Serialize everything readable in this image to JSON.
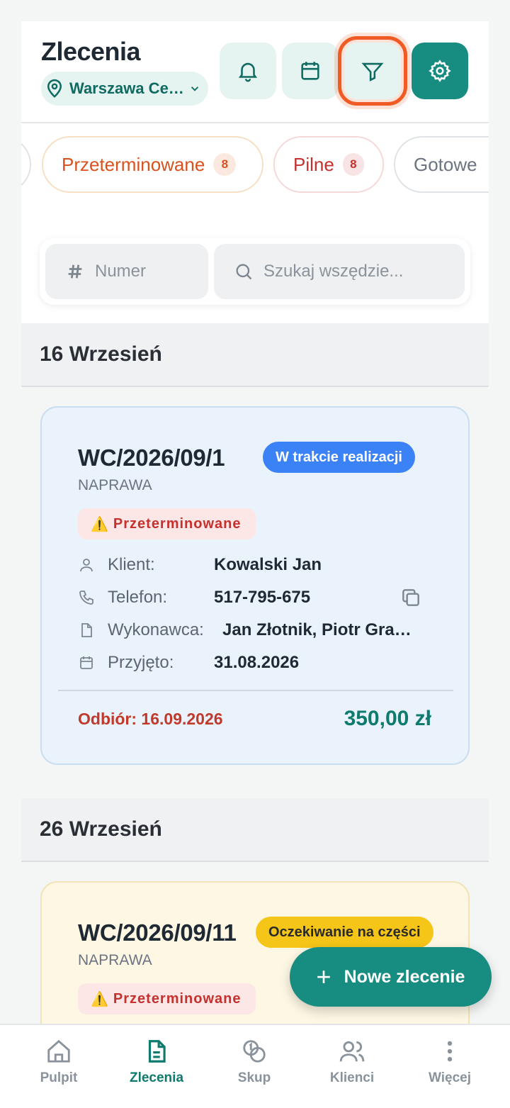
{
  "header": {
    "title": "Zlecenia",
    "location": "Warszawa Ce…",
    "buttons": [
      "bell-icon",
      "calendar-icon",
      "filter-icon",
      "gear-icon"
    ]
  },
  "chips": {
    "overdue": {
      "label": "Przeterminowane",
      "count": "8"
    },
    "urgent": {
      "label": "Pilne",
      "count": "8"
    },
    "ready": {
      "label": "Gotowe"
    }
  },
  "search": {
    "number_placeholder": "Numer",
    "all_placeholder": "Szukaj wszędzie..."
  },
  "groups": [
    {
      "date": "16 Wrzesień",
      "order": {
        "number": "WC/2026/09/1",
        "type": "NAPRAWA",
        "status": "W trakcie realizacji",
        "overdue": "Przeterminowane",
        "client_label": "Klient:",
        "client": "Kowalski Jan",
        "phone_label": "Telefon:",
        "phone": "517-795-675",
        "worker_label": "Wykonawca:",
        "worker": "Jan Złotnik, Piotr Gra…",
        "accepted_label": "Przyjęto:",
        "accepted": "31.08.2026",
        "pickup": "Odbiór: 16.09.2026",
        "price": "350,00 zł"
      }
    },
    {
      "date": "26 Wrzesień",
      "order": {
        "number": "WC/2026/09/11",
        "type": "NAPRAWA",
        "status": "Oczekiwanie na części",
        "overdue": "Przeterminowane"
      }
    }
  ],
  "fab": {
    "label": "Nowe zlecenie"
  },
  "nav": {
    "items": [
      {
        "label": "Pulpit",
        "icon": "home-icon"
      },
      {
        "label": "Zlecenia",
        "icon": "document-icon"
      },
      {
        "label": "Skup",
        "icon": "coins-icon"
      },
      {
        "label": "Klienci",
        "icon": "users-icon"
      },
      {
        "label": "Więcej",
        "icon": "more-vertical-icon"
      }
    ],
    "active": "Zlecenia"
  },
  "colors": {
    "accent": "#178c80",
    "overdue": "#c6312e",
    "status_blue": "#3b82f6",
    "status_yellow": "#f5c518",
    "focus_outline": "#f05a24"
  }
}
